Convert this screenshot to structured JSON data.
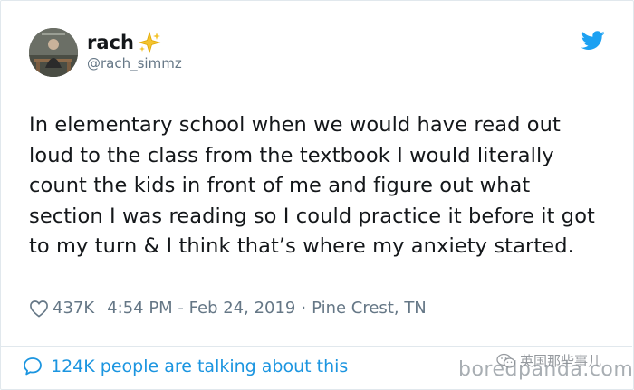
{
  "tweet": {
    "display_name": "rach",
    "handle": "@rach_simmz",
    "text": "In elementary school when we would have read out loud to the class from the textbook I would literally count the kids in front of me and figure out what section I was reading so I could practice it before it got to my turn & I think that’s where my anxiety started.",
    "likes": "437K",
    "timestamp": "4:54 PM - Feb 24, 2019",
    "separator": "·",
    "location": "Pine Crest, TN",
    "conversation": "124K people are talking about this"
  },
  "watermark": {
    "wechat_text": "英国那些事儿",
    "site_text": "boredpanda.com"
  },
  "colors": {
    "text": "#14171a",
    "secondary": "#657786",
    "accent": "#1b95e0",
    "sparkle": "#f4c430",
    "border": "#e1e8ed"
  },
  "icons": {
    "sparkle": "sparkle-emoji-icon",
    "bird": "twitter-bird-icon",
    "heart": "heart-outline-icon",
    "bubble": "speech-bubble-icon",
    "wechat": "wechat-icon"
  }
}
